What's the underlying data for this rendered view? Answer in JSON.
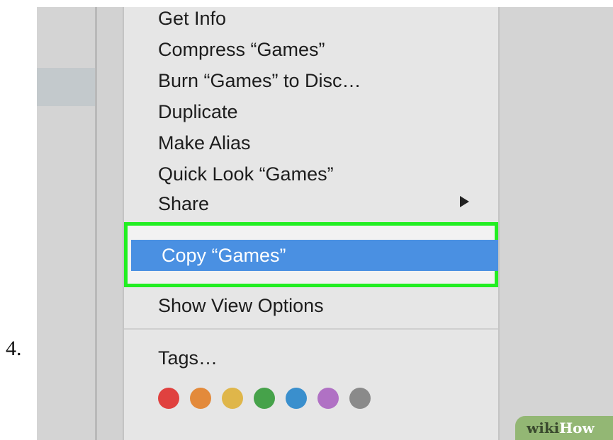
{
  "step_number": "4.",
  "context_menu": {
    "items": [
      {
        "label": "Get Info"
      },
      {
        "label": "Compress “Games”"
      },
      {
        "label": "Burn “Games” to Disc…"
      },
      {
        "label": "Duplicate"
      },
      {
        "label": "Make Alias"
      },
      {
        "label": "Quick Look “Games”"
      },
      {
        "label": "Share",
        "submenu": true
      }
    ],
    "selected_item": {
      "label": "Copy “Games”"
    },
    "show_view_options": {
      "label": "Show View Options"
    },
    "tags": {
      "label": "Tags…"
    },
    "tag_colors": [
      {
        "name": "red",
        "color": "#e0413f"
      },
      {
        "name": "orange",
        "color": "#e38a3b"
      },
      {
        "name": "yellow",
        "color": "#dfb64a"
      },
      {
        "name": "green",
        "color": "#46a24a"
      },
      {
        "name": "blue",
        "color": "#3a8fcd"
      },
      {
        "name": "purple",
        "color": "#b071c4"
      },
      {
        "name": "gray",
        "color": "#8a8a8a"
      }
    ]
  },
  "highlight_color": "#22ee22",
  "selection_color": "#4a90e2",
  "watermark": {
    "wiki": "wiki",
    "how": "How"
  }
}
